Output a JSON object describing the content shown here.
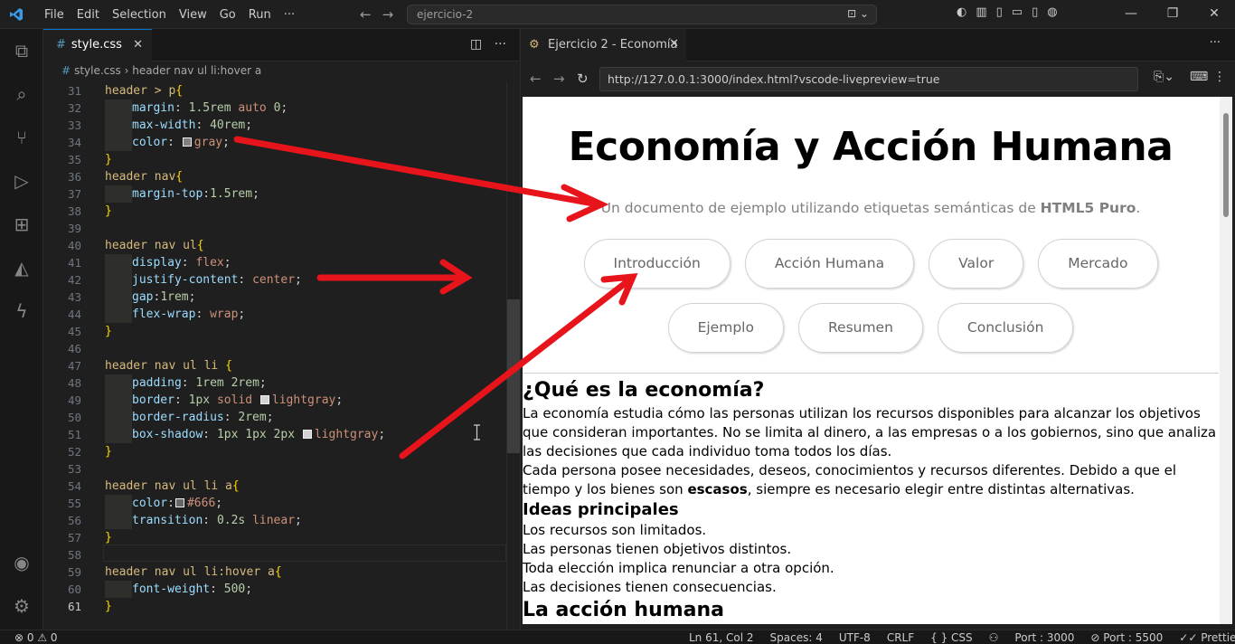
{
  "titlebar": {
    "menu": [
      "File",
      "Edit",
      "Selection",
      "View",
      "Go",
      "Run",
      "···"
    ],
    "search_text": "ejercicio-2"
  },
  "editor": {
    "tab_label": "style.css",
    "breadcrumb_file": "style.css",
    "breadcrumb_symbol": "header nav ul li:hover a",
    "lines": [
      {
        "n": "31",
        "t": [
          [
            "sel",
            "header > p"
          ],
          [
            "brc",
            "{"
          ]
        ]
      },
      {
        "n": "32",
        "ind": 1,
        "t": [
          [
            "prop",
            "margin"
          ],
          [
            "punc",
            ": "
          ],
          [
            "num",
            "1.5rem"
          ],
          [
            "punc",
            " "
          ],
          [
            "val",
            "auto"
          ],
          [
            "punc",
            " "
          ],
          [
            "num",
            "0"
          ],
          [
            "punc",
            ";"
          ]
        ]
      },
      {
        "n": "33",
        "ind": 1,
        "t": [
          [
            "prop",
            "max-width"
          ],
          [
            "punc",
            ": "
          ],
          [
            "num",
            "40rem"
          ],
          [
            "punc",
            ";"
          ]
        ]
      },
      {
        "n": "34",
        "ind": 1,
        "t": [
          [
            "prop",
            "color"
          ],
          [
            "punc",
            ": "
          ],
          [
            "sw",
            "gray"
          ],
          [
            "val",
            "gray"
          ],
          [
            "punc",
            ";"
          ]
        ]
      },
      {
        "n": "35",
        "t": [
          [
            "brc",
            "}"
          ]
        ]
      },
      {
        "n": "36",
        "t": [
          [
            "sel",
            "header nav"
          ],
          [
            "brc",
            "{"
          ]
        ]
      },
      {
        "n": "37",
        "ind": 1,
        "t": [
          [
            "prop",
            "margin-top"
          ],
          [
            "punc",
            ":"
          ],
          [
            "num",
            "1.5rem"
          ],
          [
            "punc",
            ";"
          ]
        ]
      },
      {
        "n": "38",
        "t": [
          [
            "brc",
            "}"
          ]
        ]
      },
      {
        "n": "39",
        "t": []
      },
      {
        "n": "40",
        "t": [
          [
            "sel",
            "header nav ul"
          ],
          [
            "brc",
            "{"
          ]
        ]
      },
      {
        "n": "41",
        "ind": 1,
        "t": [
          [
            "prop",
            "display"
          ],
          [
            "punc",
            ": "
          ],
          [
            "val",
            "flex"
          ],
          [
            "punc",
            ";"
          ]
        ]
      },
      {
        "n": "42",
        "ind": 1,
        "t": [
          [
            "prop",
            "justify-content"
          ],
          [
            "punc",
            ": "
          ],
          [
            "val",
            "center"
          ],
          [
            "punc",
            ";"
          ]
        ]
      },
      {
        "n": "43",
        "ind": 1,
        "t": [
          [
            "prop",
            "gap"
          ],
          [
            "punc",
            ":"
          ],
          [
            "num",
            "1rem"
          ],
          [
            "punc",
            ";"
          ]
        ]
      },
      {
        "n": "44",
        "ind": 1,
        "t": [
          [
            "prop",
            "flex-wrap"
          ],
          [
            "punc",
            ": "
          ],
          [
            "val",
            "wrap"
          ],
          [
            "punc",
            ";"
          ]
        ]
      },
      {
        "n": "45",
        "t": [
          [
            "brc",
            "}"
          ]
        ]
      },
      {
        "n": "46",
        "t": []
      },
      {
        "n": "47",
        "t": [
          [
            "sel",
            "header nav ul li "
          ],
          [
            "brc",
            "{"
          ]
        ]
      },
      {
        "n": "48",
        "ind": 1,
        "t": [
          [
            "prop",
            "padding"
          ],
          [
            "punc",
            ": "
          ],
          [
            "num",
            "1rem 2rem"
          ],
          [
            "punc",
            ";"
          ]
        ]
      },
      {
        "n": "49",
        "ind": 1,
        "t": [
          [
            "prop",
            "border"
          ],
          [
            "punc",
            ": "
          ],
          [
            "num",
            "1px"
          ],
          [
            "punc",
            " "
          ],
          [
            "val",
            "solid"
          ],
          [
            "punc",
            " "
          ],
          [
            "sw",
            "lightgray"
          ],
          [
            "val",
            "lightgray"
          ],
          [
            "punc",
            ";"
          ]
        ]
      },
      {
        "n": "50",
        "ind": 1,
        "t": [
          [
            "prop",
            "border-radius"
          ],
          [
            "punc",
            ": "
          ],
          [
            "num",
            "2rem"
          ],
          [
            "punc",
            ";"
          ]
        ]
      },
      {
        "n": "51",
        "ind": 1,
        "t": [
          [
            "prop",
            "box-shadow"
          ],
          [
            "punc",
            ": "
          ],
          [
            "num",
            "1px 1px 2px"
          ],
          [
            "punc",
            " "
          ],
          [
            "sw",
            "lightgray"
          ],
          [
            "val",
            "lightgray"
          ],
          [
            "punc",
            ";"
          ]
        ]
      },
      {
        "n": "52",
        "t": [
          [
            "brc",
            "}"
          ]
        ]
      },
      {
        "n": "53",
        "t": []
      },
      {
        "n": "54",
        "t": [
          [
            "sel",
            "header nav ul li a"
          ],
          [
            "brc",
            "{"
          ]
        ]
      },
      {
        "n": "55",
        "ind": 1,
        "t": [
          [
            "prop",
            "color"
          ],
          [
            "punc",
            ":"
          ],
          [
            "sw",
            "#666"
          ],
          [
            "val",
            "#666"
          ],
          [
            "punc",
            ";"
          ]
        ]
      },
      {
        "n": "56",
        "ind": 1,
        "t": [
          [
            "prop",
            "transition"
          ],
          [
            "punc",
            ": "
          ],
          [
            "num",
            "0.2s"
          ],
          [
            "punc",
            " "
          ],
          [
            "val",
            "linear"
          ],
          [
            "punc",
            ";"
          ]
        ]
      },
      {
        "n": "57",
        "t": [
          [
            "brc",
            "}"
          ]
        ]
      },
      {
        "n": "58",
        "t": []
      },
      {
        "n": "59",
        "t": [
          [
            "sel",
            "header nav ul li:hover a"
          ],
          [
            "brc",
            "{"
          ]
        ]
      },
      {
        "n": "60",
        "ind": 1,
        "t": [
          [
            "prop",
            "font-weight"
          ],
          [
            "punc",
            ": "
          ],
          [
            "num",
            "500"
          ],
          [
            "punc",
            ";"
          ]
        ]
      },
      {
        "n": "61",
        "t": [
          [
            "brc",
            "}"
          ]
        ],
        "current": true
      }
    ]
  },
  "browser": {
    "tab_label": "Ejercicio 2 - Economía",
    "url": "http://127.0.0.1:3000/index.html?vscode-livepreview=true"
  },
  "page": {
    "title": "Economía y Acción Humana",
    "subtitle_pre": "Un documento de ejemplo utilizando etiquetas semánticas de ",
    "subtitle_bold": "HTML5 Puro",
    "subtitle_post": ".",
    "nav": [
      "Introducción",
      "Acción Humana",
      "Valor",
      "Mercado",
      "Ejemplo",
      "Resumen",
      "Conclusión"
    ],
    "section1_title": "¿Qué es la economía?",
    "section1_p1": "La economía estudia cómo las personas utilizan los recursos disponibles para alcanzar los objetivos que consideran importantes. No se limita al dinero, a las empresas o a los gobiernos, sino que analiza las decisiones que cada individuo toma todos los días.",
    "section1_p2_pre": "Cada persona posee necesidades, deseos, conocimientos y recursos diferentes. Debido a que el tiempo y los bienes son ",
    "section1_p2_bold": "escasos",
    "section1_p2_post": ", siempre es necesario elegir entre distintas alternativas.",
    "ideas_title": "Ideas principales",
    "ideas": [
      "Los recursos son limitados.",
      "Las personas tienen objetivos distintos.",
      "Toda elección implica renunciar a otra opción.",
      "Las decisiones tienen consecuencias."
    ],
    "section2_title": "La acción humana"
  },
  "status": {
    "problems": "⊗ 0 ⚠ 0",
    "items": [
      "Ln 61, Col 2",
      "Spaces: 4",
      "UTF-8",
      "CRLF",
      "{ } CSS",
      "⚇",
      "Port : 3000",
      "⊘ Port : 5500",
      "✓✓ Prettier",
      "🔔"
    ]
  },
  "colors": {
    "accent": "#0078d4",
    "annotation": "#e8141b"
  }
}
